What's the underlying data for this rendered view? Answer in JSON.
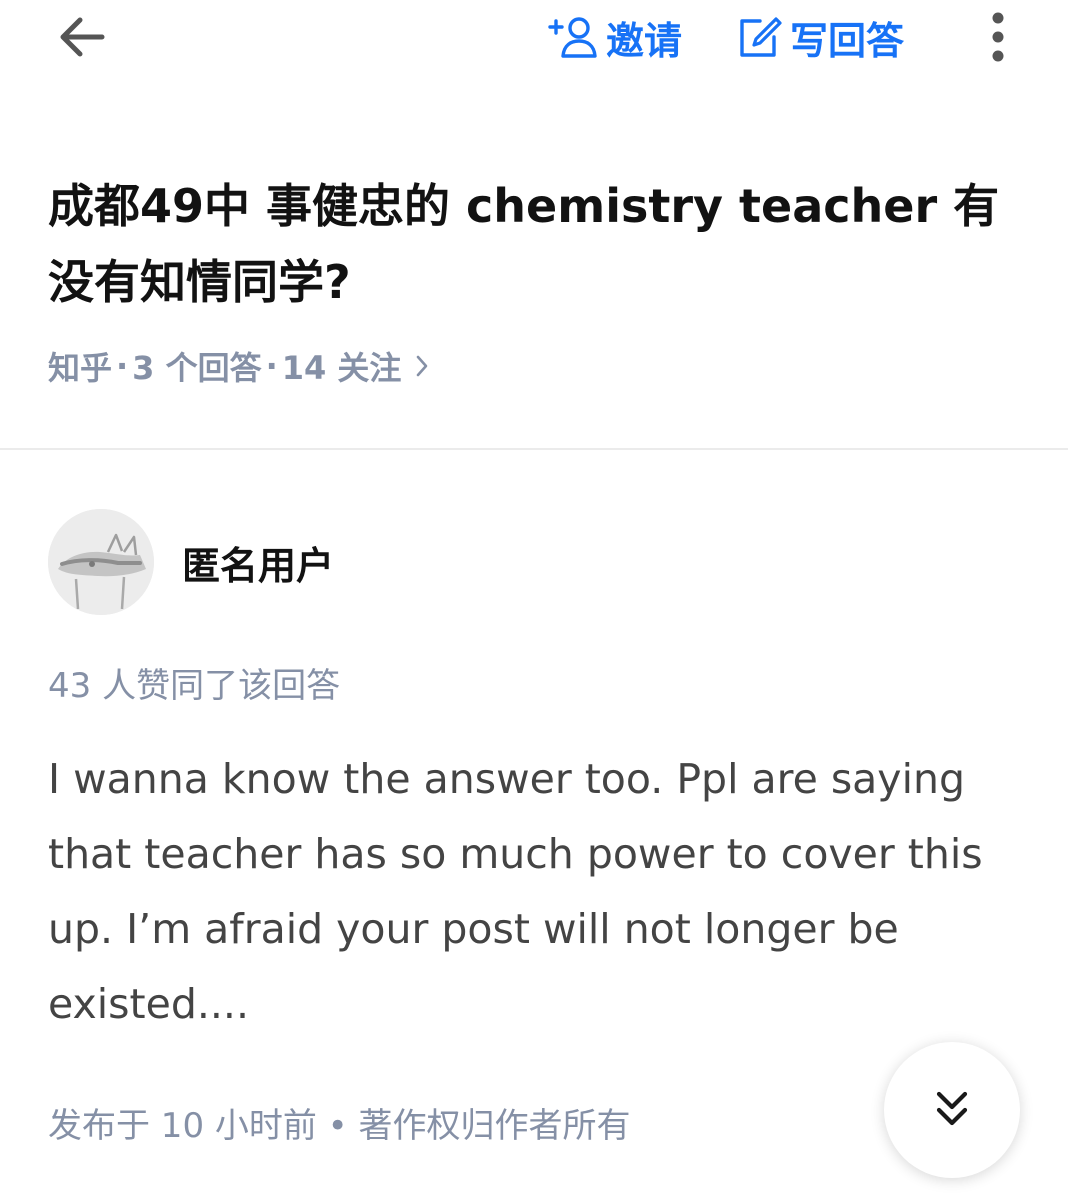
{
  "topbar": {
    "back_icon": "arrow-left-icon",
    "invite_label": "邀请",
    "invite_icon": "person-add-icon",
    "write_label": "写回答",
    "write_icon": "edit-icon",
    "more_icon": "more-vertical-icon",
    "accent_color": "#1772f6"
  },
  "question": {
    "title": "成都49中 事健忠的 chemistry teacher 有没有知情同学?",
    "meta": {
      "source": "知乎",
      "answers": "3 个回答",
      "followers": "14 关注",
      "separator": "·"
    }
  },
  "answer": {
    "author_name": "匿名用户",
    "avatar_icon": "anonymous-avatar-icon",
    "votes_text": "43 人赞同了该回答",
    "body": "I wanna know the answer too. Ppl are saying that teacher has so much power to cover this up. I’m afraid your post will not longer be existed....",
    "footer": "发布于 10 小时前 • 著作权归作者所有"
  },
  "fab": {
    "icon": "double-chevron-down-icon"
  }
}
